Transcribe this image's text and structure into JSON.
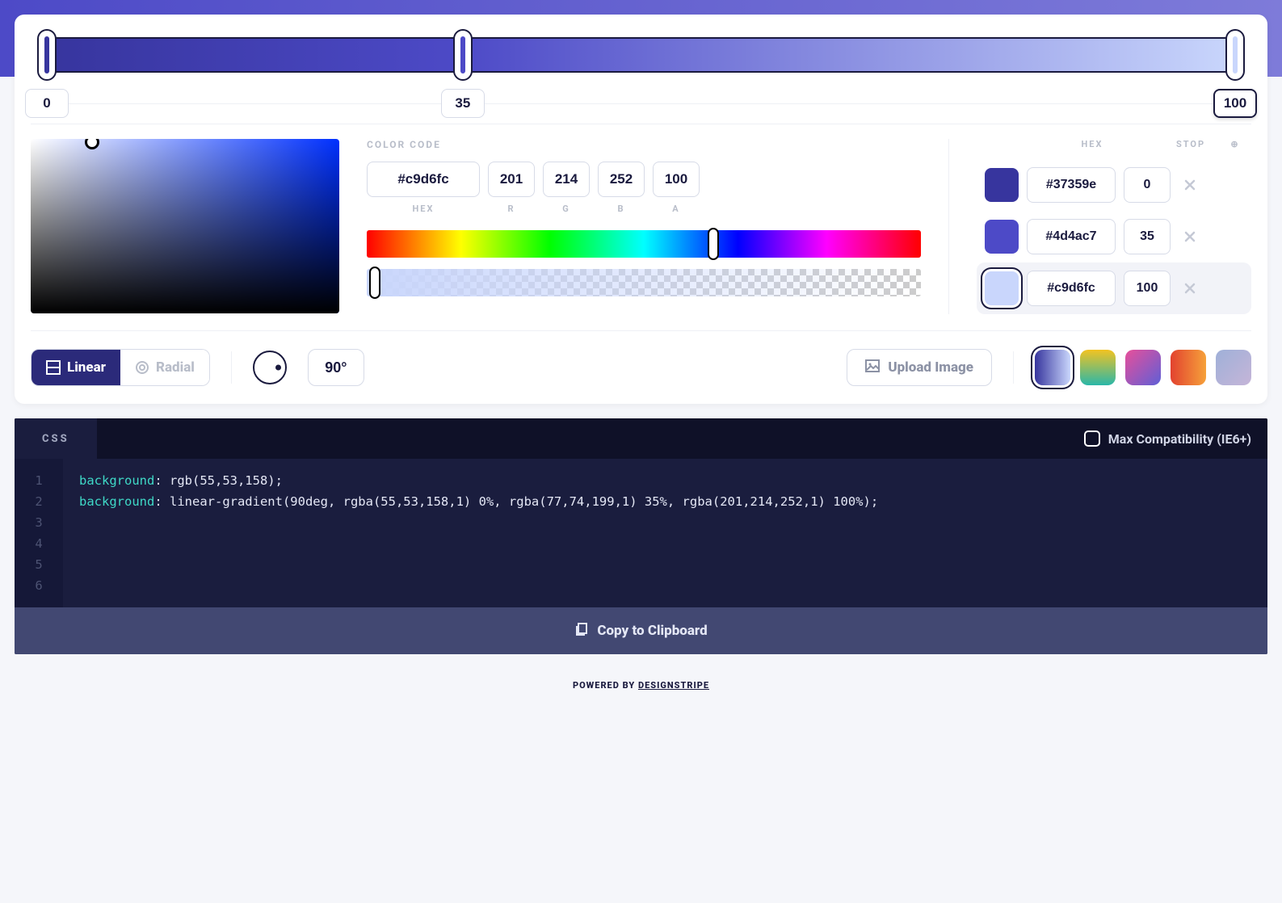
{
  "gradient": {
    "stops": [
      {
        "hex": "#37359e",
        "pos": 0
      },
      {
        "hex": "#4d4ac7",
        "pos": 35
      },
      {
        "hex": "#c9d6fc",
        "pos": 100
      }
    ],
    "selected_index": 2,
    "angle": "90°"
  },
  "colorcode": {
    "label": "COLOR CODE",
    "hex": "#c9d6fc",
    "r": "201",
    "g": "214",
    "b": "252",
    "a": "100",
    "hex_label": "HEX",
    "r_label": "R",
    "g_label": "G",
    "b_label": "B",
    "a_label": "A"
  },
  "stops_table": {
    "hex_header": "HEX",
    "stop_header": "STOP",
    "add_header": "⊕"
  },
  "type_toggle": {
    "linear": "Linear",
    "radial": "Radial"
  },
  "upload_label": "Upload Image",
  "presets": [
    {
      "css": "linear-gradient(90deg,#37359e,#c9d6fc)",
      "active": true
    },
    {
      "css": "linear-gradient(180deg,#f3c321,#2ab7a9)"
    },
    {
      "css": "linear-gradient(135deg,#e84f9a,#5f5fd6)"
    },
    {
      "css": "linear-gradient(90deg,#e2422f,#f6a13a)"
    },
    {
      "css": "linear-gradient(135deg,#9fb0d8,#c5b5d8)"
    }
  ],
  "code": {
    "tab": "CSS",
    "compat_label": "Max Compatibility (IE6+)",
    "lines": [
      {
        "prop": "background",
        "val": "rgb(55,53,158);"
      },
      {
        "prop": "background",
        "val": "linear-gradient(90deg, rgba(55,53,158,1) 0%, rgba(77,74,199,1) 35%, rgba(201,214,252,1) 100%);"
      }
    ],
    "line_count": 6,
    "copy_label": "Copy to Clipboard"
  },
  "footer": {
    "prefix": "POWERED BY ",
    "brand": "DESIGNSTRIPE"
  }
}
